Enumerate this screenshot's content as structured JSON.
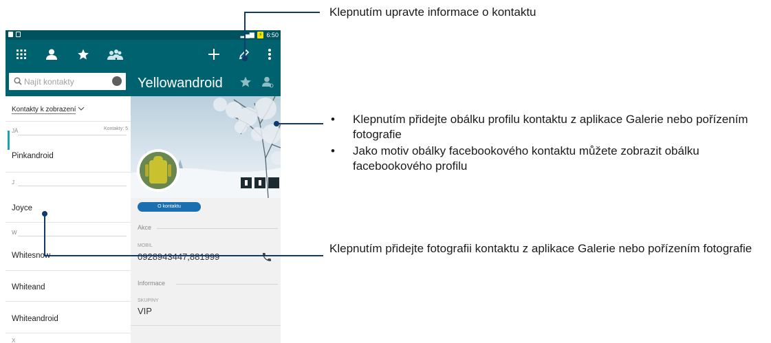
{
  "status_bar": {
    "time": "6:50"
  },
  "search": {
    "placeholder": "Najít kontakty"
  },
  "contact": {
    "name": "Yellowandroid",
    "about_button": "O kontaktu",
    "actions_heading": "Akce",
    "phone_label": "MOBIL",
    "phone_value": "0928943447,881999",
    "info_heading": "Informace",
    "groups_label": "SKUPINY",
    "groups_value": "VIP"
  },
  "contacts_list": {
    "filter_label": "Kontakty k zobrazení",
    "count_label": "Kontakty: 5",
    "sections": [
      {
        "letter": "JÁ",
        "items": [
          "Pinkandroid"
        ]
      },
      {
        "letter": "J",
        "items": [
          "Joyce"
        ]
      },
      {
        "letter": "W",
        "items": [
          "Whitesnow",
          "Whiteand",
          "Whiteandroid"
        ]
      }
    ],
    "next_section_peek": "X"
  },
  "annotations": {
    "edit": "Klepnutím upravte informace o kontaktu",
    "cover_bullets": [
      "Klepnutím přidejte obálku profilu kontaktu z aplikace Galerie nebo pořízením fotografie",
      "Jako motiv obálky facebookového kontaktu můžete zobrazit obálku facebookového profilu"
    ],
    "photo": "Klepnutím přidejte fotografii kontaktu z aplikace Galerie nebo pořízením fotografie"
  },
  "icons": {
    "toolbar": [
      "dialpad-icon",
      "person-icon",
      "star-icon",
      "groups-icon",
      "add-icon",
      "edit-icon",
      "more-icon"
    ]
  },
  "colors": {
    "toolbar": "#00626f",
    "status_bar": "#00535e",
    "accent_button": "#1a6fb1",
    "callout_line": "#0f3a6b"
  }
}
